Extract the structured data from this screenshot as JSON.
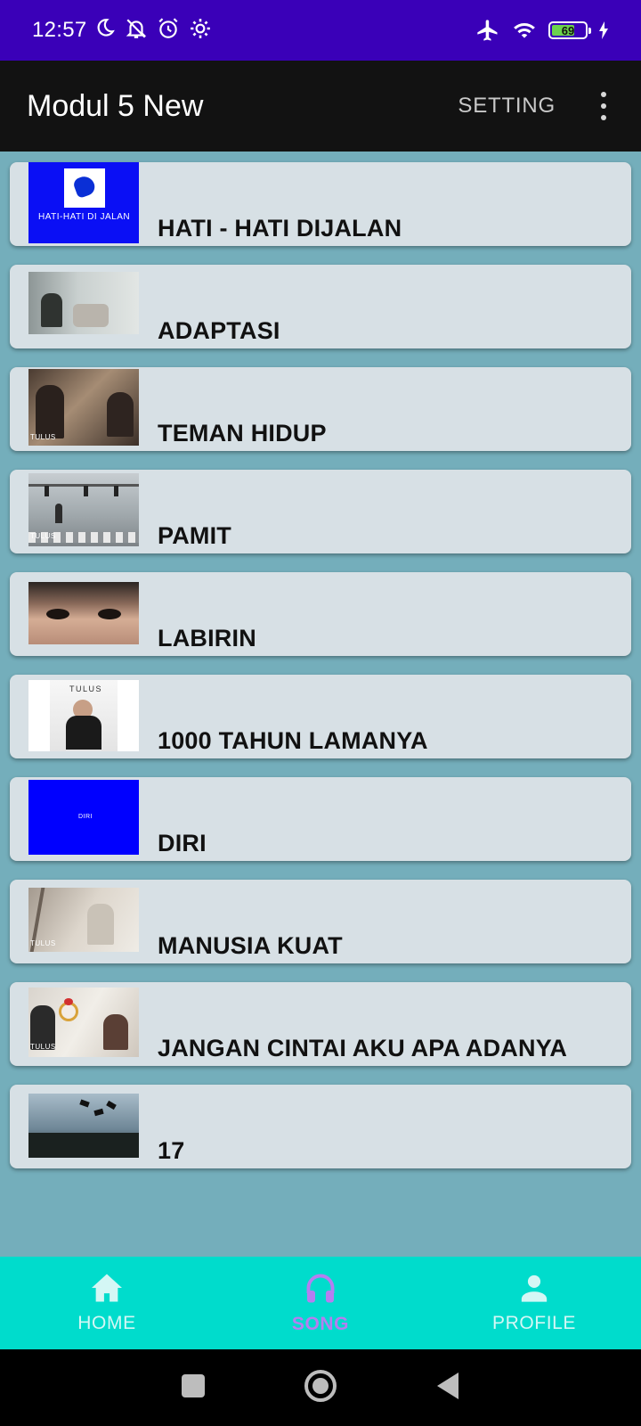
{
  "status_bar": {
    "time": "12:57",
    "battery": "69",
    "battery_level": 0.69
  },
  "app_bar": {
    "title": "Modul 5 New",
    "action": "SETTING"
  },
  "songs": [
    {
      "title": "HATI - HATI DIJALAN",
      "thumb_text": "HATI-HATI DI JALAN"
    },
    {
      "title": "ADAPTASI"
    },
    {
      "title": "TEMAN HIDUP",
      "thumb_text": "TULUS"
    },
    {
      "title": "PAMIT",
      "thumb_text": "TULUS"
    },
    {
      "title": "LABIRIN"
    },
    {
      "title": "1000 TAHUN LAMANYA",
      "thumb_text": "TULUS"
    },
    {
      "title": "DIRI",
      "thumb_text": "DIRI"
    },
    {
      "title": "MANUSIA KUAT",
      "thumb_text": "TULUS"
    },
    {
      "title": "JANGAN CINTAI AKU APA ADANYA",
      "thumb_text": "TULUS"
    },
    {
      "title": "17"
    }
  ],
  "bottom_nav": {
    "items": [
      {
        "label": "HOME",
        "icon": "home-icon"
      },
      {
        "label": "SONG",
        "icon": "headphones-icon",
        "active": true
      },
      {
        "label": "PROFILE",
        "icon": "person-icon"
      }
    ]
  },
  "colors": {
    "status_bar": "#3a00b8",
    "app_bar": "#121212",
    "background": "#74aebb",
    "bottom_nav": "#00dccc",
    "accent": "#b57ef0"
  }
}
